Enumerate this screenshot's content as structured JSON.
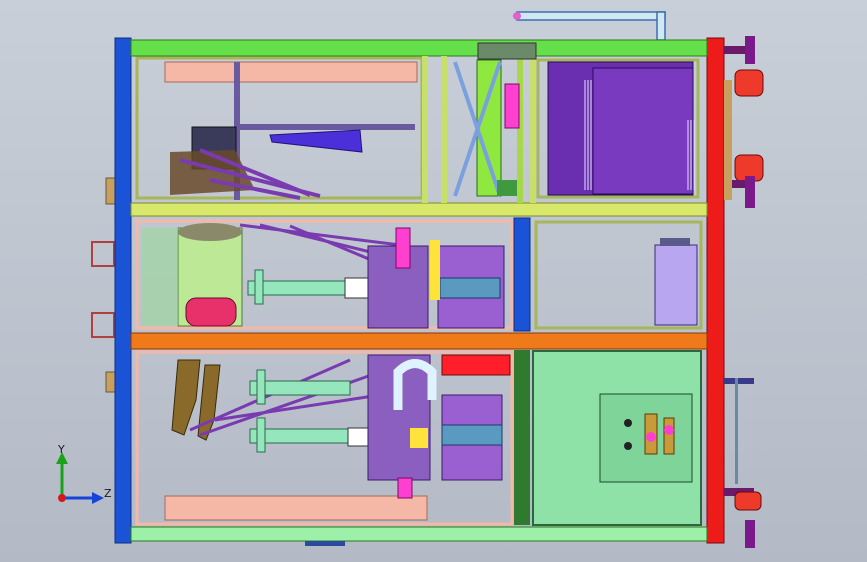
{
  "view": {
    "background_top": "#c9cfd8",
    "background_bottom": "#b3bac6"
  },
  "palette": {
    "frame_green": "#66e04a",
    "frame_blue": "#1b53d6",
    "frame_red": "#ee1b1b",
    "frame_orange": "#f07a1a",
    "rail_yellow": "#d8e86a",
    "rail_olive": "#a7b65a",
    "panel_pink": "#f6b8a6",
    "cabinet_purple": "#6a2fb0",
    "cabinet_violet": "#9a5fd0",
    "cylinder_green": "#95e6bc",
    "control_panel": "#8ee2a8",
    "magenta": "#ff3fd0",
    "hot_red": "#ff1e2a",
    "tank_green": "#bde896"
  },
  "triad": {
    "y_label": "Y",
    "z_label": "Z",
    "y_color": "#1aa31a",
    "z_color": "#1744d8",
    "origin_color": "#d01a1a"
  }
}
